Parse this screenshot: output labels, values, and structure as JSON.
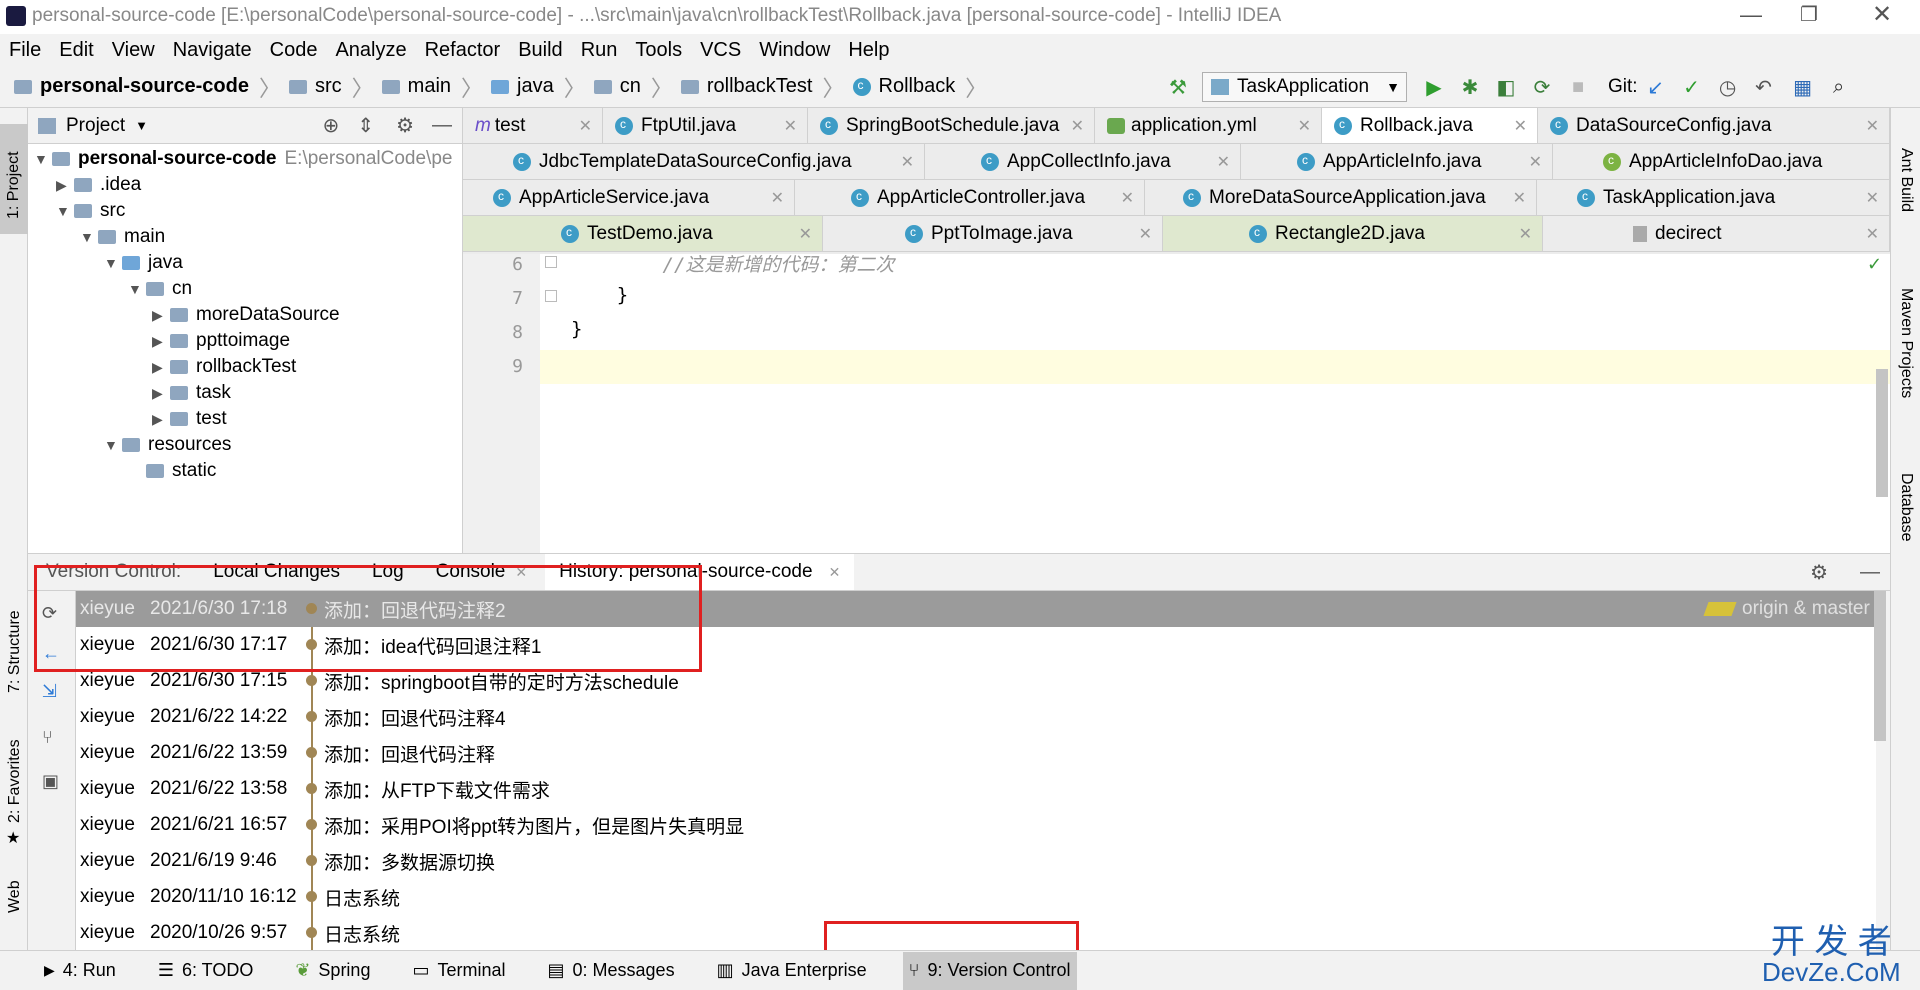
{
  "window": {
    "title": "personal-source-code [E:\\personalCode\\personal-source-code] - ...\\src\\main\\java\\cn\\rollbackTest\\Rollback.java [personal-source-code] - IntelliJ IDEA"
  },
  "menu": [
    "File",
    "Edit",
    "View",
    "Navigate",
    "Code",
    "Analyze",
    "Refactor",
    "Build",
    "Run",
    "Tools",
    "VCS",
    "Window",
    "Help"
  ],
  "breadcrumb": [
    "personal-source-code",
    "src",
    "main",
    "java",
    "cn",
    "rollbackTest",
    "Rollback"
  ],
  "toolbar": {
    "run_config": "TaskApplication",
    "git_label": "Git:"
  },
  "left_strip": {
    "project": "1: Project",
    "structure": "7: Structure",
    "favorites": "2: Favorites",
    "web": "Web"
  },
  "right_strip": {
    "ant": "Ant Build",
    "maven": "Maven Projects",
    "database": "Database"
  },
  "project_panel": {
    "header": "Project",
    "root": "personal-source-code",
    "root_path": "E:\\personalCode\\pe",
    "items": [
      ".idea",
      "src",
      "main",
      "java",
      "cn",
      "moreDataSource",
      "ppttoimage",
      "rollbackTest",
      "task",
      "test",
      "resources",
      "static"
    ]
  },
  "tabs": [
    [
      "test",
      "FtpUtil.java",
      "SpringBootSchedule.java",
      "application.yml",
      "Rollback.java",
      "DataSourceConfig.java"
    ],
    [
      "JdbcTemplateDataSourceConfig.java",
      "AppCollectInfo.java",
      "AppArticleInfo.java",
      "AppArticleInfoDao.java"
    ],
    [
      "AppArticleService.java",
      "AppArticleController.java",
      "MoreDataSourceApplication.java",
      "TaskApplication.java"
    ],
    [
      "TestDemo.java",
      "PptToImage.java",
      "Rectangle2D.java",
      "decirect"
    ]
  ],
  "editor": {
    "line_numbers": [
      "6",
      "7",
      "8",
      "9"
    ],
    "lines": [
      "        //这是新增的代码：第二次",
      "    }",
      "}",
      ""
    ]
  },
  "vc_tabs": [
    "Version Control:",
    "Local Changes",
    "Log",
    "Console",
    "History: personal-source-code"
  ],
  "vc_branch": "origin & master",
  "commits": [
    {
      "author": "xieyue",
      "date": "2021/6/30 17:18",
      "msg": "添加：回退代码注释2"
    },
    {
      "author": "xieyue",
      "date": "2021/6/30 17:17",
      "msg": "添加：idea代码回退注释1"
    },
    {
      "author": "xieyue",
      "date": "2021/6/30 17:15",
      "msg": "添加：springboot自带的定时方法schedule"
    },
    {
      "author": "xieyue",
      "date": "2021/6/22 14:22",
      "msg": "添加：回退代码注释4"
    },
    {
      "author": "xieyue",
      "date": "2021/6/22 13:59",
      "msg": "添加：回退代码注释"
    },
    {
      "author": "xieyue",
      "date": "2021/6/22 13:58",
      "msg": "添加：从FTP下载文件需求"
    },
    {
      "author": "xieyue",
      "date": "2021/6/21 16:57",
      "msg": "添加：采用POI将ppt转为图片，但是图片失真明显"
    },
    {
      "author": "xieyue",
      "date": "2021/6/19 9:46",
      "msg": "添加：多数据源切换"
    },
    {
      "author": "xieyue",
      "date": "2020/11/10 16:12",
      "msg": "日志系统"
    },
    {
      "author": "xieyue",
      "date": "2020/10/26 9:57",
      "msg": "日志系统"
    }
  ],
  "bottom_tools": [
    "4: Run",
    "6: TODO",
    "Spring",
    "Terminal",
    "0: Messages",
    "Java Enterprise",
    "9: Version Control"
  ],
  "watermark": {
    "line1": "开 发 者",
    "line2": "DevZe.CoM"
  },
  "colors": {
    "highlight_box": "#e02020",
    "graph": "#a08655",
    "selected_row": "#9b9b9b"
  }
}
